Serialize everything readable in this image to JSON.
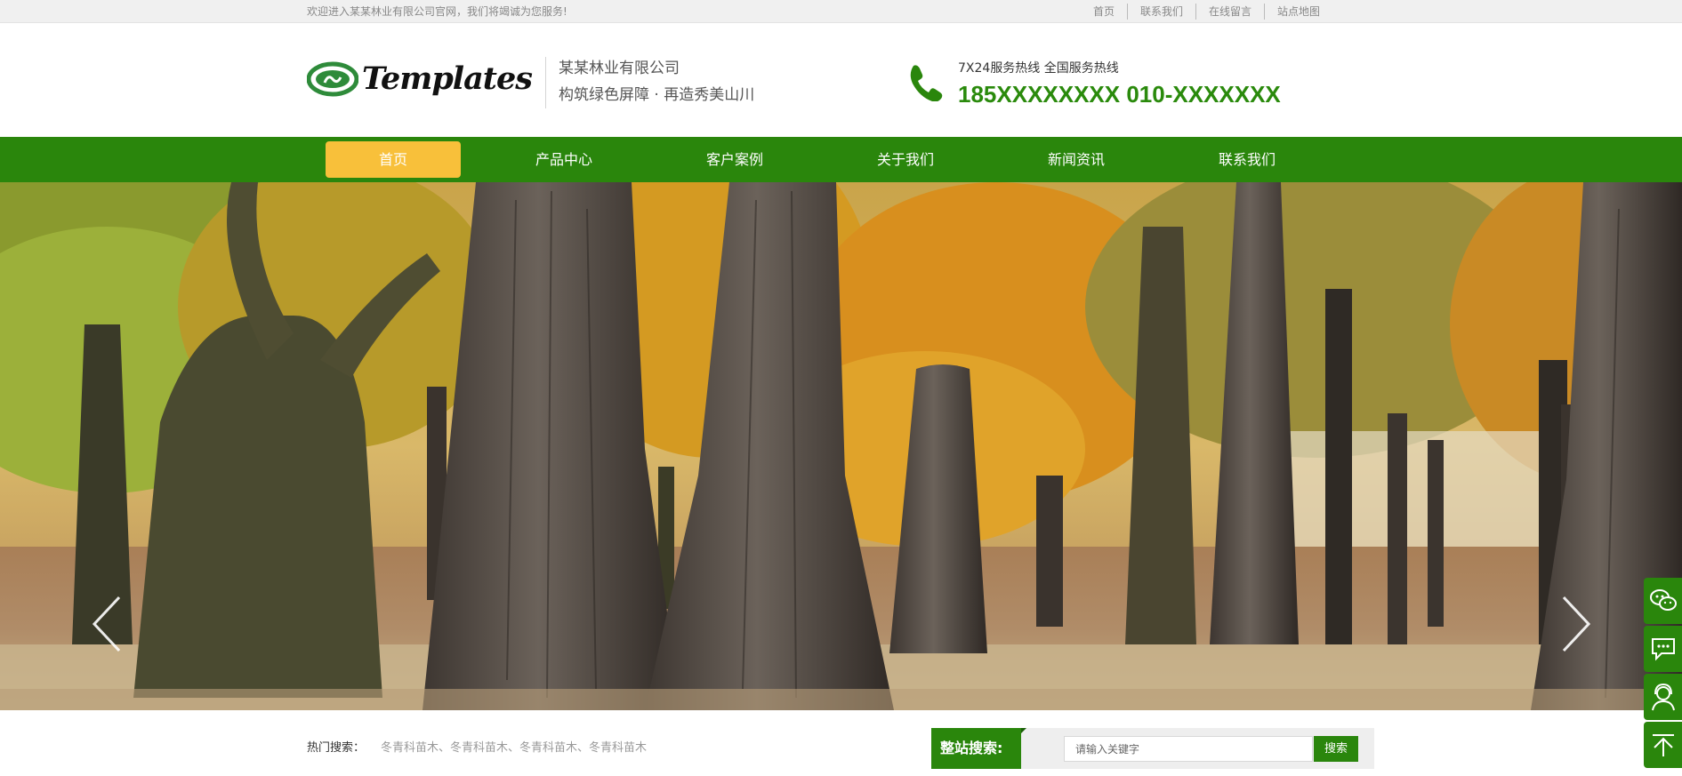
{
  "topbar": {
    "welcome": "欢迎进入某某林业有限公司官网，我们将竭诚为您服务!",
    "links": [
      "首页",
      "联系我们",
      "在线留言",
      "站点地图"
    ]
  },
  "header": {
    "logo_text": "Templates",
    "company_name": "某某林业有限公司",
    "slogan": "构筑绿色屏障 · 再造秀美山川",
    "hotline_label": "7X24服务热线 全国服务热线",
    "hotline_number": "185XXXXXXXX 010-XXXXXXX"
  },
  "nav": {
    "items": [
      "首页",
      "产品中心",
      "客户案例",
      "关于我们",
      "新闻资讯",
      "联系我们"
    ],
    "active_index": 0
  },
  "search": {
    "hot_label": "热门搜索：",
    "hot_keywords": "冬青科苗木、冬青科苗木、冬青科苗木、冬青科苗木",
    "title": "整站搜索:",
    "placeholder": "请输入关键字",
    "button": "搜索"
  },
  "banner": {
    "description_icons": [
      "prev-arrow",
      "next-arrow"
    ]
  },
  "sidetools": [
    "wechat-icon",
    "message-icon",
    "customer-service-icon",
    "back-to-top-icon"
  ],
  "colors": {
    "brand_green": "#2a860c",
    "nav_active": "#f8c03a",
    "hotline_green": "#2a8a0c"
  }
}
